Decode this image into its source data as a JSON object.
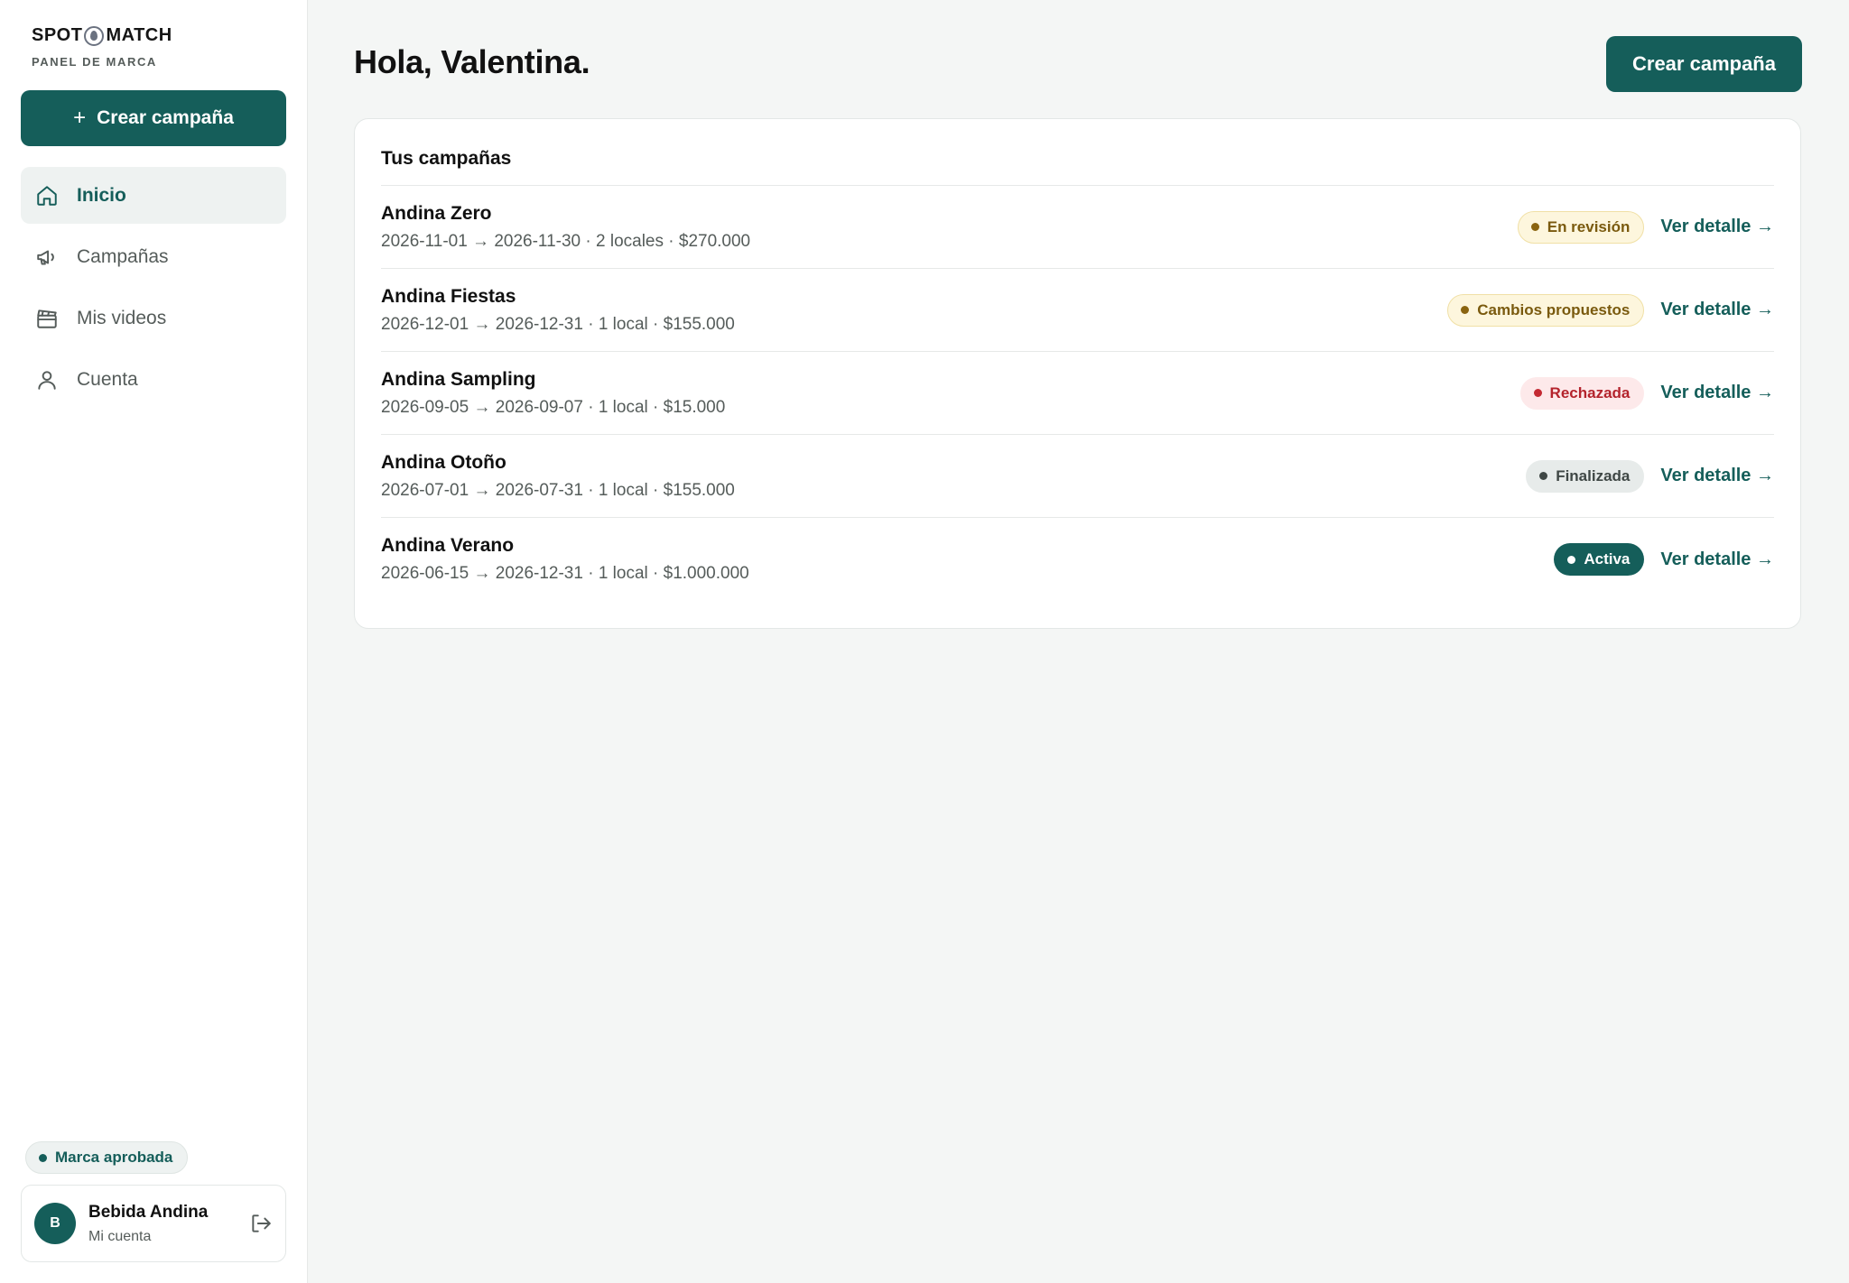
{
  "brand": {
    "logo_left": "SPOT",
    "logo_right": "MATCH",
    "subtitle": "PANEL DE MARCA"
  },
  "sidebar": {
    "create_label": "Crear campaña",
    "items": [
      {
        "label": "Inicio",
        "icon": "home-icon",
        "active": true
      },
      {
        "label": "Campañas",
        "icon": "megaphone-icon",
        "active": false
      },
      {
        "label": "Mis videos",
        "icon": "clapperboard-icon",
        "active": false
      },
      {
        "label": "Cuenta",
        "icon": "user-icon",
        "active": false
      }
    ],
    "approved_badge": "Marca aprobada",
    "account": {
      "initial": "B",
      "name": "Bebida Andina",
      "sub": "Mi cuenta"
    }
  },
  "header": {
    "greeting": "Hola, Valentina.",
    "create_label": "Crear campaña"
  },
  "campaigns": {
    "title": "Tus campañas",
    "link_label": "Ver detalle →",
    "rows": [
      {
        "name": "Andina Zero",
        "meta": "2026-11-01 → 2026-11-30 · 2 locales · $270.000",
        "status": "En revisión"
      },
      {
        "name": "Andina Fiestas",
        "meta": "2026-12-01 → 2026-12-31 · 1 local · $155.000",
        "status": "Cambios propuestos"
      },
      {
        "name": "Andina Sampling",
        "meta": "2026-09-05 → 2026-09-07 · 1 local · $15.000",
        "status": "Rechazada"
      },
      {
        "name": "Andina Otoño",
        "meta": "2026-07-01 → 2026-07-31 · 1 local · $155.000",
        "status": "Finalizada"
      },
      {
        "name": "Andina Verano",
        "meta": "2026-06-15 → 2026-12-31 · 1 local · $1.000.000",
        "status": "Activa"
      }
    ]
  },
  "colors": {
    "accent": "#155e5a",
    "background": "#f4f6f5",
    "review": "#8a6410",
    "rejected": "#c42a33",
    "finished": "#3f4745"
  }
}
